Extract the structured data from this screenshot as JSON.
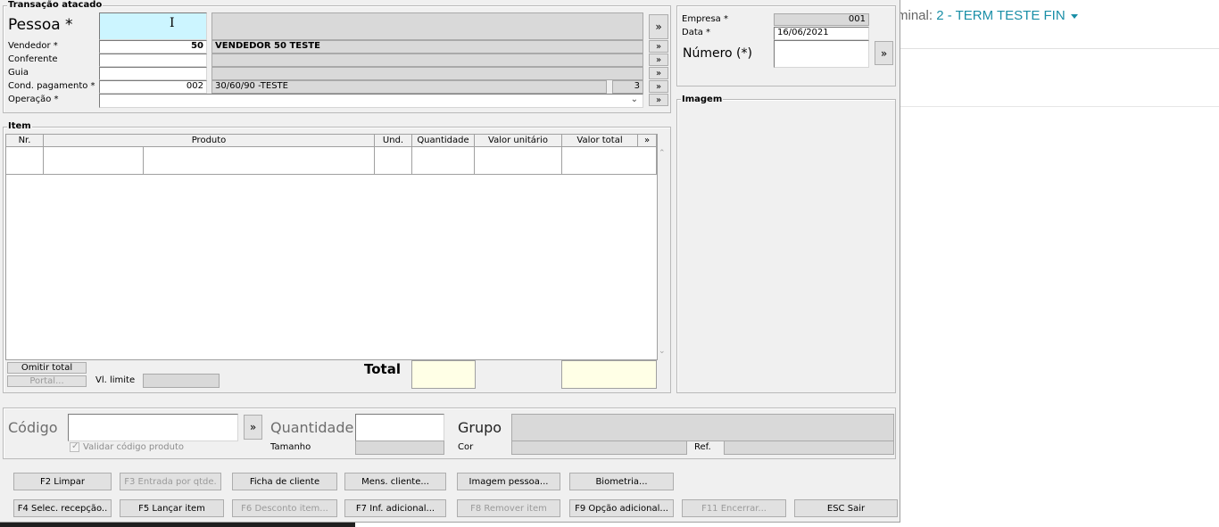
{
  "page_bg": "#ffffff",
  "topnav": {
    "prefix": "minal: ",
    "terminal": "2 - TERM TESTE FIN",
    "accent": "#1a8fa7",
    "caret_icon": "caret-down-icon"
  },
  "header": {
    "group_title": "Transação atacado",
    "pessoa_label": "Pessoa *",
    "vendedor_label": "Vendedor *",
    "vendedor_code": "50",
    "vendedor_name": "VENDEDOR 50 TESTE",
    "conferente_label": "Conferente",
    "guia_label": "Guia",
    "cond_label": "Cond. pagamento *",
    "cond_code": "002",
    "cond_name": "30/60/90 -TESTE",
    "cond_num": "3",
    "operacao_label": "Operação *",
    "lookup": "»"
  },
  "right": {
    "empresa_label": "Empresa *",
    "empresa_value": "001",
    "data_label": "Data *",
    "data_value": "16/06/2021",
    "numero_label": "Número (*)",
    "imagem_title": "Imagem"
  },
  "items": {
    "group_title": "Item",
    "columns": [
      "Nr.",
      "Produto",
      "Und.",
      "Quantidade",
      "Valor unitário",
      "Valor total",
      "»"
    ],
    "omitir_label": "Omitir total",
    "portal_label": "Portal...",
    "vl_limite_label": "Vl. limite",
    "total_label": "Total"
  },
  "entry": {
    "codigo_label": "Código",
    "validar_label": "Validar código produto",
    "quantidade_label": "Quantidade",
    "tamanho_label": "Tamanho",
    "grupo_label": "Grupo",
    "cor_label": "Cor",
    "ref_label": "Ref."
  },
  "buttons_row1": [
    {
      "label": "F2 Limpar",
      "enabled": true
    },
    {
      "label": "F3 Entrada por qtde.",
      "enabled": false
    },
    {
      "label": "Ficha de cliente",
      "enabled": true
    },
    {
      "label": "Mens. cliente...",
      "enabled": true
    },
    {
      "label": "Imagem pessoa...",
      "enabled": true
    },
    {
      "label": "Biometria...",
      "enabled": true
    }
  ],
  "buttons_row2": [
    {
      "label": "F4 Selec. recepção..",
      "enabled": true
    },
    {
      "label": "F5 Lançar item",
      "enabled": true
    },
    {
      "label": "F6 Desconto item...",
      "enabled": false
    },
    {
      "label": "F7 Inf. adicional...",
      "enabled": true
    },
    {
      "label": "F8 Remover item",
      "enabled": false
    },
    {
      "label": "F9 Opção adicional...",
      "enabled": true
    },
    {
      "label": "F11 Encerrar...",
      "enabled": false
    },
    {
      "label": "ESC Sair",
      "enabled": true
    }
  ]
}
